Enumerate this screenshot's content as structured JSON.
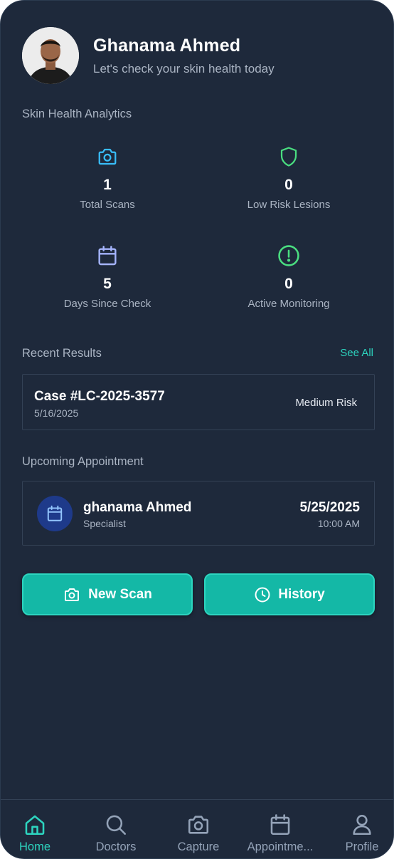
{
  "user": {
    "name": "Ghanama Ahmed",
    "greeting": "Let's check your skin health today"
  },
  "analytics": {
    "title": "Skin Health Analytics",
    "stats": [
      {
        "value": "1",
        "label": "Total Scans",
        "icon": "camera-icon",
        "color": "#38bdf8"
      },
      {
        "value": "0",
        "label": "Low Risk Lesions",
        "icon": "shield-icon",
        "color": "#4ade80"
      },
      {
        "value": "5",
        "label": "Days Since Check",
        "icon": "calendar-icon",
        "color": "#a5b4fc"
      },
      {
        "value": "0",
        "label": "Active Monitoring",
        "icon": "alert-circle-icon",
        "color": "#4ade80"
      }
    ]
  },
  "recent": {
    "title": "Recent Results",
    "see_all": "See All",
    "case": {
      "id": "Case #LC-2025-3577",
      "date": "5/16/2025",
      "risk": "Medium Risk"
    }
  },
  "appointment": {
    "title": "Upcoming Appointment",
    "name": "ghanama Ahmed",
    "role": "Specialist",
    "date": "5/25/2025",
    "time": "10:00 AM",
    "icon": "calendar-icon"
  },
  "actions": {
    "new_scan": "New Scan",
    "history": "History"
  },
  "nav": {
    "items": [
      {
        "label": "Home",
        "icon": "home-icon",
        "active": true
      },
      {
        "label": "Doctors",
        "icon": "search-icon",
        "active": false
      },
      {
        "label": "Capture",
        "icon": "camera-icon",
        "active": false
      },
      {
        "label": "Appointme...",
        "icon": "calendar-icon",
        "active": false
      },
      {
        "label": "Profile",
        "icon": "user-icon",
        "active": false
      }
    ]
  },
  "colors": {
    "background": "#1e293b",
    "accent": "#14b8a6",
    "accent_light": "#2dd4bf",
    "border": "#334155"
  }
}
